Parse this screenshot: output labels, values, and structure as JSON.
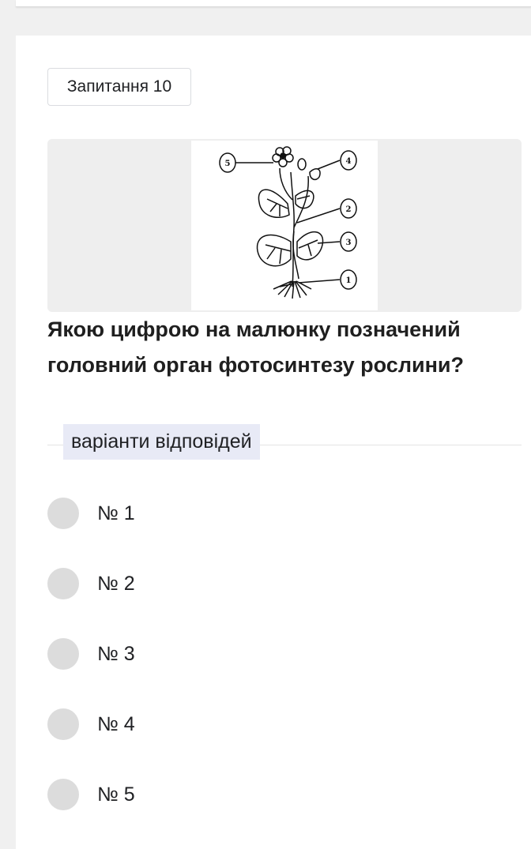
{
  "question": {
    "badge_label": "Запитання 10",
    "text": "Якою цифрою на малюнку позначений головний орган фотосинтезу рослини?"
  },
  "figure": {
    "callouts": [
      "5",
      "4",
      "2",
      "3",
      "1"
    ]
  },
  "answers": {
    "section_label": "варіанти відповідей",
    "options": [
      {
        "label": "№ 1"
      },
      {
        "label": "№ 2"
      },
      {
        "label": "№ 3"
      },
      {
        "label": "№ 4"
      },
      {
        "label": "№ 5"
      }
    ]
  },
  "colors": {
    "page_background": "#f0f0f0",
    "card_background": "#ffffff",
    "image_background": "#eeeeee",
    "section_label_background": "#e8eaf6",
    "radio_fill": "#dcdcdc",
    "text": "#202124"
  }
}
